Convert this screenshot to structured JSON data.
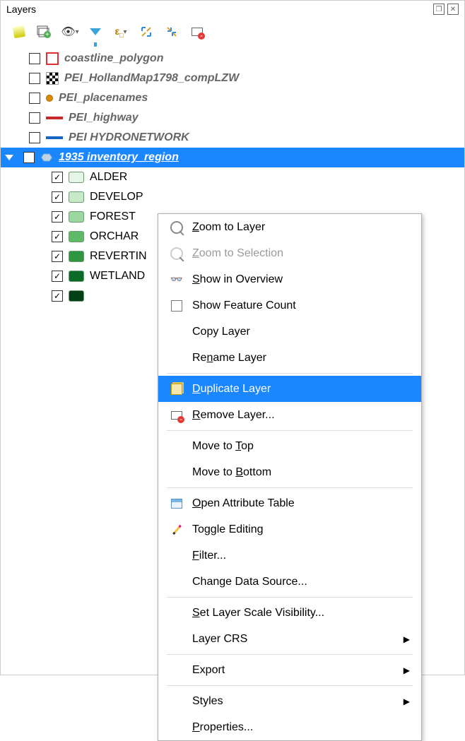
{
  "panel": {
    "title": "Layers"
  },
  "layers": {
    "coastline": {
      "label": "coastline_polygon"
    },
    "holland": {
      "label": "PEI_HollandMap1798_compLZW"
    },
    "placenames": {
      "label": "PEI_placenames"
    },
    "highway": {
      "label": "PEI_highway"
    },
    "hydro": {
      "label": "PEI HYDRONETWORK"
    },
    "inventory": {
      "label": "1935 inventory_region"
    },
    "children": [
      {
        "label": "ALDER",
        "color": "#e7f5e8"
      },
      {
        "label": "DEVELOP",
        "color": "#c6e9c8"
      },
      {
        "label": "FOREST",
        "color": "#9dd7a0"
      },
      {
        "label": "ORCHAR",
        "color": "#5fba67"
      },
      {
        "label": "REVERTIN",
        "color": "#2e9641"
      },
      {
        "label": "WETLAND",
        "color": "#0d6b28"
      },
      {
        "label": "",
        "color": "#034016"
      }
    ]
  },
  "menu": {
    "zoom_layer": "Zoom to Layer",
    "zoom_selection": "Zoom to Selection",
    "show_overview": "Show in Overview",
    "feature_count": "Show Feature Count",
    "copy": "Copy Layer",
    "rename": "Rename Layer",
    "duplicate": "Duplicate Layer",
    "remove": "Remove Layer...",
    "move_top": "Move to Top",
    "move_bottom": "Move to Bottom",
    "attr_table": "Open Attribute Table",
    "toggle_edit": "Toggle Editing",
    "filter": "Filter...",
    "change_src": "Change Data Source...",
    "scale_vis": "Set Layer Scale Visibility...",
    "crs": "Layer CRS",
    "export": "Export",
    "styles": "Styles",
    "properties": "Properties..."
  }
}
